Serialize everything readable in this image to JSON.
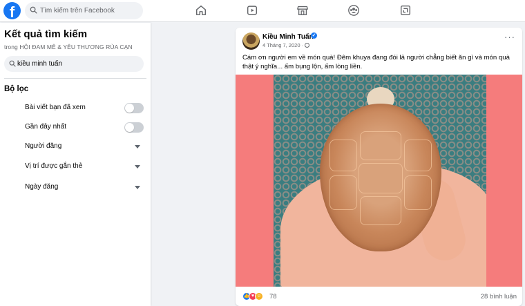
{
  "topbar": {
    "logo": "f",
    "search_placeholder": "Tìm kiếm trên Facebook",
    "nav": [
      "home-icon",
      "watch-icon",
      "marketplace-icon",
      "groups-icon",
      "gaming-icon"
    ]
  },
  "sidebar": {
    "title": "Kết quả tìm kiếm",
    "subtitle": "trong HỘI ĐAM MÊ & YÊU THƯƠNG RÙA CẠN",
    "search_value": "kiều minh tuấn",
    "filter_heading": "Bộ lọc",
    "filters": [
      {
        "label": "Bài viết bạn đã xem",
        "control": "toggle",
        "on": false
      },
      {
        "label": "Gần đây nhất",
        "control": "toggle",
        "on": false
      },
      {
        "label": "Người đăng",
        "control": "dropdown"
      },
      {
        "label": "Vị trí được gắn thẻ",
        "control": "dropdown"
      },
      {
        "label": "Ngày đăng",
        "control": "dropdown"
      }
    ]
  },
  "post": {
    "author": "Kiều Minh Tuấn",
    "date": "4 Tháng 7, 2020 ·",
    "more": "···",
    "text": "Cám ơn người em về món quà! Đêm khuya đang đói lả người chẳng biết ăn gì và món quà thật ý nghĩa... ấm bụng lộn, ấm lòng liền.",
    "reaction_count": "78",
    "comments": "28 bình luận"
  },
  "colors": {
    "brand": "#1877f2",
    "photo_bg": "#f57c7c"
  }
}
